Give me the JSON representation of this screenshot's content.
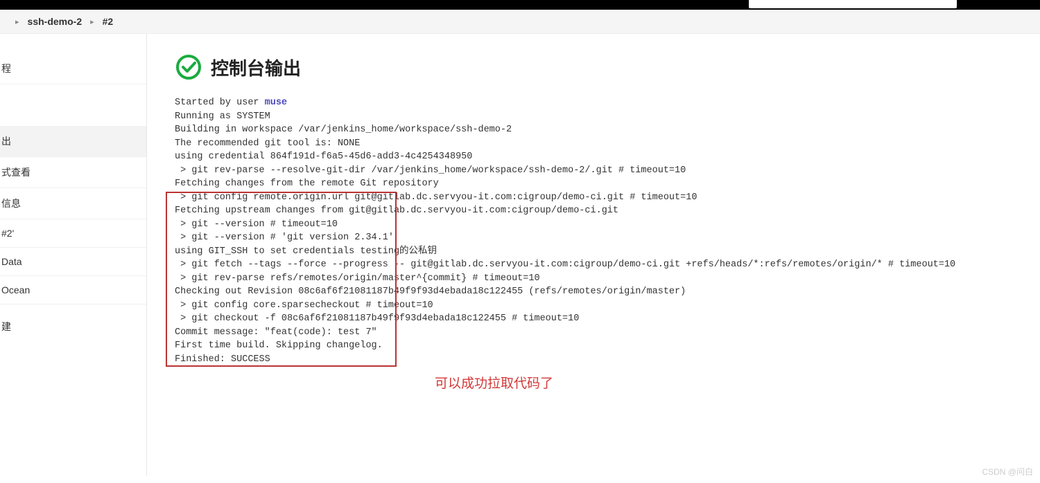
{
  "breadcrumb": {
    "item1": "ssh-demo-2",
    "item2": "#2"
  },
  "sidebar": {
    "items": [
      "程",
      "出",
      "式查看",
      "信息",
      "#2'",
      "Data",
      "Ocean",
      "建"
    ]
  },
  "page": {
    "title": "控制台输出"
  },
  "console": {
    "prefix": "Started by user ",
    "user": "muse",
    "lines": "Running as SYSTEM\nBuilding in workspace /var/jenkins_home/workspace/ssh-demo-2\nThe recommended git tool is: NONE\nusing credential 864f191d-f6a5-45d6-add3-4c4254348950\n > git rev-parse --resolve-git-dir /var/jenkins_home/workspace/ssh-demo-2/.git # timeout=10\nFetching changes from the remote Git repository\n > git config remote.origin.url git@gitlab.dc.servyou-it.com:cigroup/demo-ci.git # timeout=10\nFetching upstream changes from git@gitlab.dc.servyou-it.com:cigroup/demo-ci.git\n > git --version # timeout=10\n > git --version # 'git version 2.34.1'\nusing GIT_SSH to set credentials testing的公私钥\n > git fetch --tags --force --progress -- git@gitlab.dc.servyou-it.com:cigroup/demo-ci.git +refs/heads/*:refs/remotes/origin/* # timeout=10\n > git rev-parse refs/remotes/origin/master^{commit} # timeout=10\nChecking out Revision 08c6af6f21081187b49f9f93d4ebada18c122455 (refs/remotes/origin/master)\n > git config core.sparsecheckout # timeout=10\n > git checkout -f 08c6af6f21081187b49f9f93d4ebada18c122455 # timeout=10\nCommit message: \"feat(code): test 7\"\nFirst time build. Skipping changelog.\nFinished: SUCCESS"
  },
  "annotation": {
    "text": "可以成功拉取代码了"
  },
  "watermark": "CSDN @问白"
}
